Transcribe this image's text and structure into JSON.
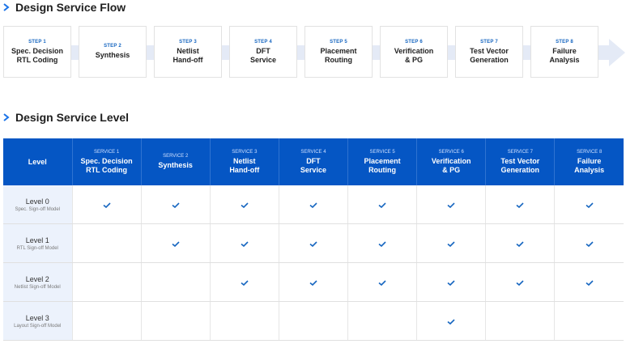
{
  "flow_section": {
    "title": "Design Service Flow"
  },
  "steps": [
    {
      "no": "STEP 1",
      "name": "Spec. Decision\nRTL Coding"
    },
    {
      "no": "STEP 2",
      "name": "Synthesis"
    },
    {
      "no": "STEP 3",
      "name": "Netlist\nHand-off"
    },
    {
      "no": "STEP 4",
      "name": "DFT\nService"
    },
    {
      "no": "STEP 5",
      "name": "Placement\nRouting"
    },
    {
      "no": "STEP 6",
      "name": "Verification\n& PG"
    },
    {
      "no": "STEP 7",
      "name": "Test Vector\nGeneration"
    },
    {
      "no": "STEP 8",
      "name": "Failure\nAnalysis"
    }
  ],
  "level_section": {
    "title": "Design Service Level"
  },
  "table": {
    "level_header": "Level",
    "services": [
      {
        "no": "SERVICE 1",
        "name": "Spec. Decision\nRTL Coding"
      },
      {
        "no": "SERVICE 2",
        "name": "Synthesis"
      },
      {
        "no": "SERVICE 3",
        "name": "Netlist\nHand-off"
      },
      {
        "no": "SERVICE 4",
        "name": "DFT\nService"
      },
      {
        "no": "SERVICE 5",
        "name": "Placement\nRouting"
      },
      {
        "no": "SERVICE 6",
        "name": "Verification\n& PG"
      },
      {
        "no": "SERVICE 7",
        "name": "Test Vector\nGeneration"
      },
      {
        "no": "SERVICE 8",
        "name": "Failure\nAnalysis"
      }
    ],
    "rows": [
      {
        "level": "Level 0",
        "model": "Spec. Sign-off Model",
        "checks": [
          true,
          true,
          true,
          true,
          true,
          true,
          true,
          true
        ]
      },
      {
        "level": "Level 1",
        "model": "RTL Sign-off Model",
        "checks": [
          false,
          true,
          true,
          true,
          true,
          true,
          true,
          true
        ]
      },
      {
        "level": "Level 2",
        "model": "Netlist Sign-off Model",
        "checks": [
          false,
          false,
          true,
          true,
          true,
          true,
          true,
          true
        ]
      },
      {
        "level": "Level 3",
        "model": "Layout Sign-off Model",
        "checks": [
          false,
          false,
          false,
          false,
          false,
          true,
          false,
          false
        ]
      }
    ]
  },
  "colors": {
    "accent": "#1565c0",
    "header_bg": "#0556c4",
    "level_cell_bg": "#ecf2fc",
    "flow_track": "#e4eaf6",
    "check": "#1565c0"
  },
  "icons": {
    "bullet": "chevron-bullet-icon",
    "check": "check-icon"
  }
}
